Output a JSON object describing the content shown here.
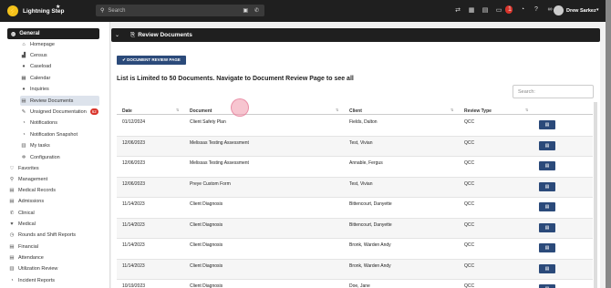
{
  "app": {
    "title": "Lightning Step",
    "logo_glyph": "⚡"
  },
  "search": {
    "placeholder": "Search"
  },
  "topbar": {
    "notification_count": "1",
    "user_name": "Drew Sarkez"
  },
  "sidebar": {
    "group_label": "General",
    "items": [
      {
        "label": "Homepage",
        "icon": "home-icon",
        "glyph": "⌂"
      },
      {
        "label": "Census",
        "icon": "chart-icon",
        "glyph": "▟"
      },
      {
        "label": "Caseload",
        "icon": "user-icon",
        "glyph": "●"
      },
      {
        "label": "Calendar",
        "icon": "calendar-icon",
        "glyph": "▦"
      },
      {
        "label": "Inquiries",
        "icon": "users-icon",
        "glyph": "●"
      },
      {
        "label": "Review Documents",
        "icon": "document-icon",
        "glyph": "▤"
      },
      {
        "label": "Unsigned Documentation",
        "icon": "pen-icon",
        "glyph": "✎",
        "badge": "62"
      },
      {
        "label": "Notifications",
        "icon": "bell-icon",
        "glyph": "◔"
      },
      {
        "label": "Notification Snapshot",
        "icon": "bell-icon",
        "glyph": "◔"
      },
      {
        "label": "My tasks",
        "icon": "tasks-icon",
        "glyph": "▥"
      },
      {
        "label": "Configuration",
        "icon": "gear-icon",
        "glyph": "✲"
      }
    ],
    "sections": [
      {
        "label": "Favorites",
        "icon": "heart-icon",
        "glyph": "♡"
      },
      {
        "label": "Management",
        "icon": "pin-icon",
        "glyph": "⚲"
      },
      {
        "label": "Medical Records",
        "icon": "records-icon",
        "glyph": "▤"
      },
      {
        "label": "Admissions",
        "icon": "admissions-icon",
        "glyph": "▤"
      },
      {
        "label": "Clinical",
        "icon": "clinical-icon",
        "glyph": "✆"
      },
      {
        "label": "Medical",
        "icon": "medical-icon",
        "glyph": "♥"
      },
      {
        "label": "Rounds and Shift Reports",
        "icon": "rounds-icon",
        "glyph": "◷"
      },
      {
        "label": "Financial",
        "icon": "financial-icon",
        "glyph": "▤"
      },
      {
        "label": "Attendance",
        "icon": "attendance-icon",
        "glyph": "▤"
      },
      {
        "label": "Utilization Review",
        "icon": "review-icon",
        "glyph": "▥"
      },
      {
        "label": "Incident Reports",
        "icon": "incident-icon",
        "glyph": "◔"
      }
    ]
  },
  "main": {
    "title": "Review Documents",
    "doc_button": "✔ DOCUMENT REVIEW PAGE",
    "notice": "List is Limited to 50 Documents. Navigate to Document Review Page to see all",
    "search_placeholder": "Search:",
    "columns": [
      "Date",
      "Document",
      "Client",
      "Review Type"
    ],
    "rows": [
      {
        "date": "01/12/2024",
        "document": "Client Safety Plan",
        "client": "Fields, Dalton",
        "type": "QCC"
      },
      {
        "date": "12/06/2023",
        "document": "Melissas Testing Assessment",
        "client": "Test, Vivian",
        "type": "QCC"
      },
      {
        "date": "12/06/2023",
        "document": "Melissas Testing Assessment",
        "client": "Annable, Fergus",
        "type": "QCC"
      },
      {
        "date": "12/06/2023",
        "document": "Preye Custom Form",
        "client": "Test, Vivian",
        "type": "QCC"
      },
      {
        "date": "11/14/2023",
        "document": "Client Diagnosis",
        "client": "Bittencourt, Danyette",
        "type": "QCC"
      },
      {
        "date": "11/14/2023",
        "document": "Client Diagnosis",
        "client": "Bittencourt, Danyette",
        "type": "QCC"
      },
      {
        "date": "11/14/2023",
        "document": "Client Diagnosis",
        "client": "Bronk, Warden Andy",
        "type": "QCC"
      },
      {
        "date": "11/14/2023",
        "document": "Client Diagnosis",
        "client": "Bronk, Warden Andy",
        "type": "QCC"
      },
      {
        "date": "10/19/2023",
        "document": "Client Diagnosis",
        "client": "Doe, Jane",
        "type": "QCC"
      }
    ]
  },
  "colors": {
    "accent": "#2b4a7a",
    "dark": "#1f1f1f",
    "badge": "#d9342b"
  }
}
